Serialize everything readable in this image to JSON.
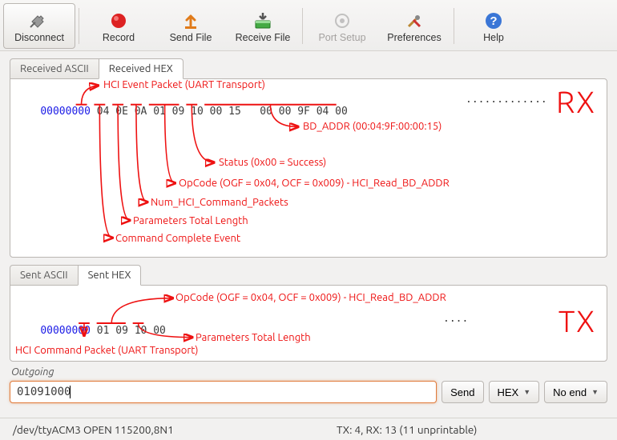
{
  "toolbar": {
    "disconnect": "Disconnect",
    "record": "Record",
    "sendfile": "Send File",
    "recvfile": "Receive File",
    "portsetup": "Port Setup",
    "prefs": "Preferences",
    "help": "Help"
  },
  "rx": {
    "tabs": {
      "ascii": "Received ASCII",
      "hex": "Received HEX"
    },
    "addr": "00000000",
    "bytes": "04 0E 0A 01 09 10 00 15   00 00 9F 04 00",
    "ascii": ".............",
    "label": "RX",
    "annotations": {
      "hci_event": "HCI Event Packet (UART Transport)",
      "cmd_complete": "Command Complete Event",
      "param_len": "Parameters Total Length",
      "num_pkts": "Num_HCI_Command_Packets",
      "opcode": "OpCode (OGF = 0x04, OCF = 0x009) - HCI_Read_BD_ADDR",
      "status": "Status (0x00 = Success)",
      "bdaddr": "BD_ADDR (00:04:9F:00:00:15)"
    }
  },
  "tx": {
    "tabs": {
      "ascii": "Sent ASCII",
      "hex": "Sent HEX"
    },
    "addr": "00000000",
    "bytes": "01 09 10 00",
    "ascii": "....",
    "label": "TX",
    "annotations": {
      "hci_cmd": "HCI Command Packet (UART Transport)",
      "opcode": "OpCode (OGF = 0x04, OCF = 0x009) - HCI_Read_BD_ADDR",
      "param_len": "Parameters Total Length"
    }
  },
  "outgoing": {
    "label": "Outgoing",
    "value": "01091000",
    "send": "Send",
    "mode": "HEX",
    "lineend": "No end"
  },
  "status": {
    "left": "/dev/ttyACM3 OPEN 115200,8N1",
    "right": "TX: 4, RX: 13 (11 unprintable)"
  }
}
